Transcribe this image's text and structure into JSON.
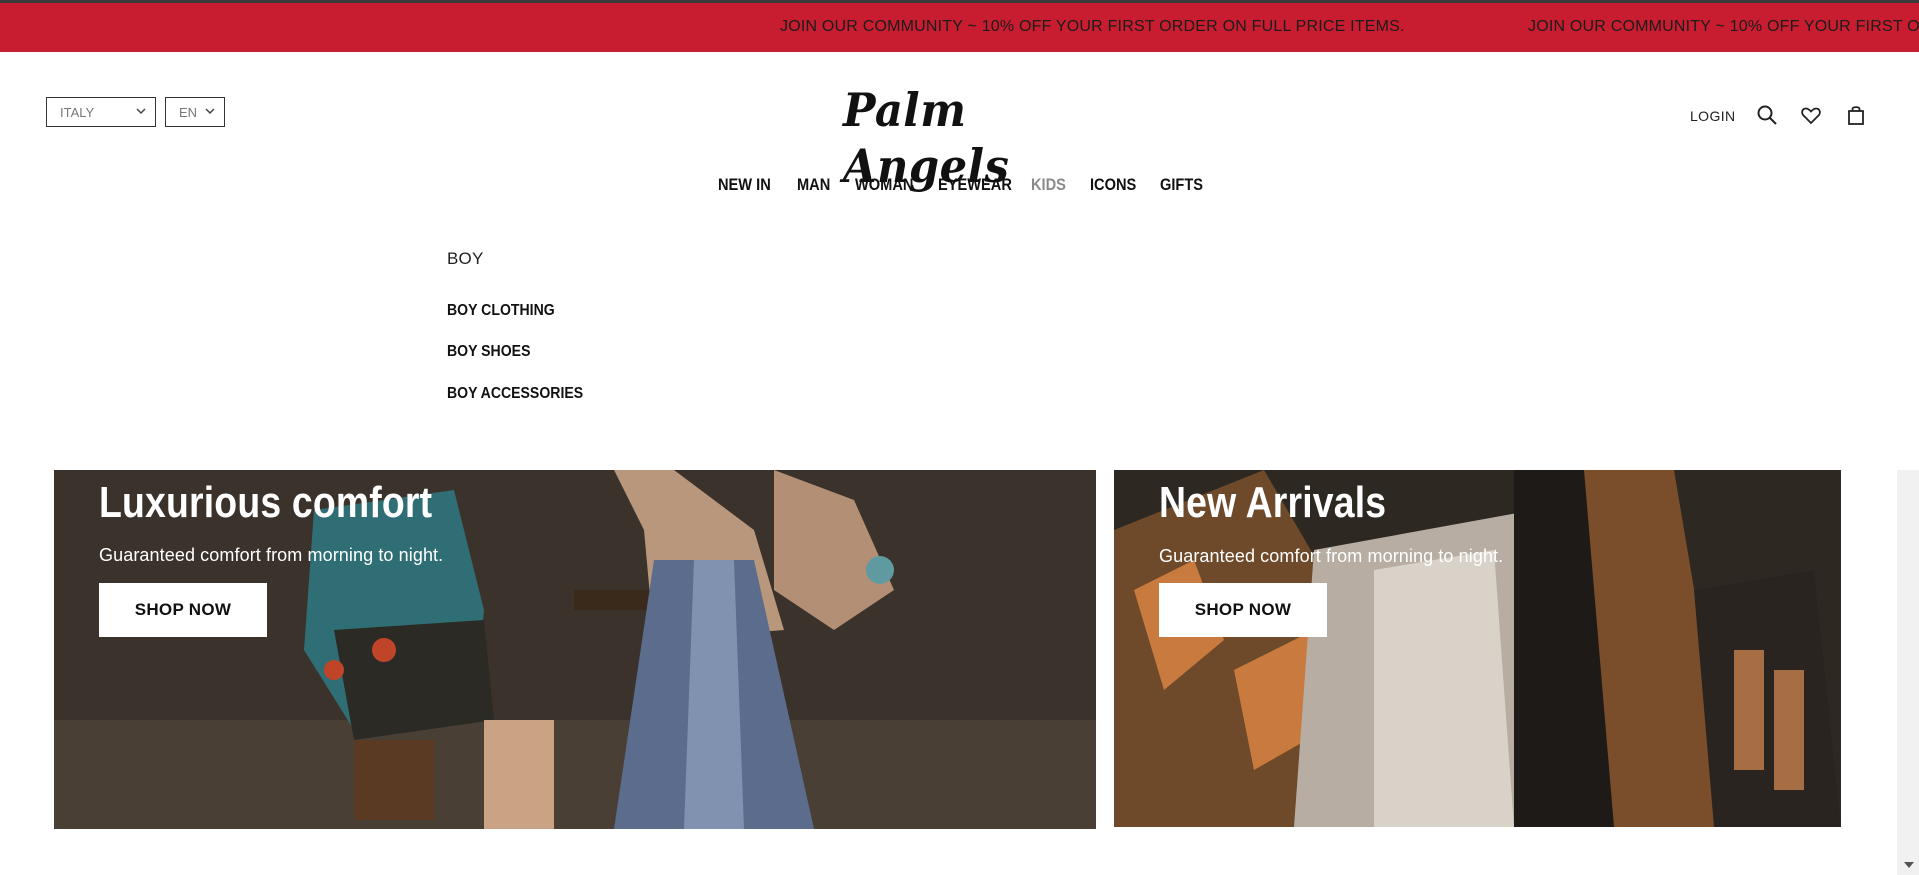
{
  "promo": {
    "message": "JOIN OUR COMMUNITY ~ 10% OFF YOUR FIRST ORDER ON FULL PRICE ITEMS.",
    "message_repeat": "JOIN OUR COMMUNITY ~ 10% OFF YOUR FIRST OI"
  },
  "header": {
    "country": "ITALY",
    "language": "EN",
    "logo": "Palm Angels",
    "login": "LOGIN",
    "icons": [
      "search-icon",
      "heart-icon",
      "bag-icon"
    ]
  },
  "nav": {
    "items": [
      "NEW IN",
      "MAN",
      "WOMAN",
      "EYEWEAR",
      "KIDS",
      "ICONS",
      "GIFTS"
    ],
    "active": "KIDS"
  },
  "submenu": {
    "title": "BOY",
    "links": [
      "BOY CLOTHING",
      "BOY SHOES",
      "BOY ACCESSORIES"
    ]
  },
  "banners": [
    {
      "title": "Luxurious comfort",
      "subtitle": "Guaranteed comfort from morning to night.",
      "button": "SHOP NOW"
    },
    {
      "title": "New Arrivals",
      "subtitle": "Guaranteed comfort from morning to night.",
      "button": "SHOP NOW"
    }
  ],
  "colors": {
    "promo_bg": "#c81d31",
    "muted_nav": "#8a8a8a"
  }
}
